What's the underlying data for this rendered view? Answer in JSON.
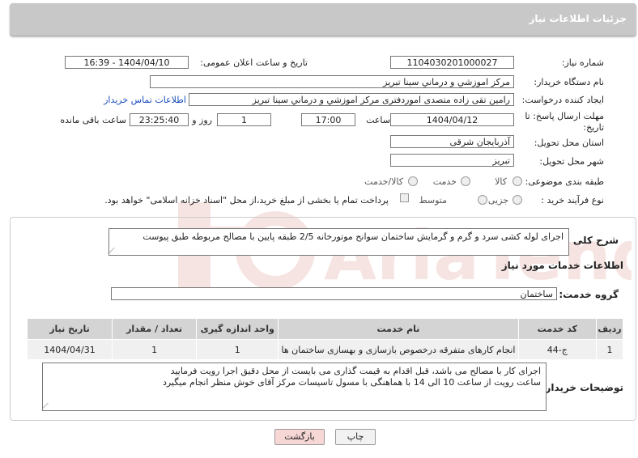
{
  "header": {
    "title": "جزئیات اطلاعات نیاز"
  },
  "fields": {
    "need_number_label": "شماره نیاز:",
    "need_number": "1104030201000027",
    "announce_label": "تاریخ و ساعت اعلان عمومی:",
    "announce_value": "1404/04/10 - 16:39",
    "buyer_label": "نام دستگاه خریدار:",
    "buyer_value": "مرکز اموزشي و درماني سينا تبريز",
    "creator_label": "ایجاد کننده درخواست:",
    "creator_value": "رامین تقی زاده متصدی اموردفتری مرکز اموزشي و درماني سينا تبريز",
    "contact_link": "اطلاعات تماس خریدار",
    "deadline_label_1": "مهلت ارسال پاسخ: تا",
    "deadline_label_2": "تاریخ:",
    "deadline_date": "1404/04/12",
    "time_label": "ساعت",
    "deadline_time": "17:00",
    "days_value": "1",
    "days_label": "روز و",
    "remaining_time": "23:25:40",
    "remaining_label": "ساعت باقی مانده",
    "province_label": "استان محل تحویل:",
    "province_value": "آذربایجان شرقی",
    "city_label": "شهر محل تحویل:",
    "city_value": "تبریز",
    "category_label": "طبقه بندی موضوعی:",
    "category_options": [
      "کالا",
      "خدمت",
      "کالا/خدمت"
    ],
    "process_label": "نوع فرآیند خرید :",
    "process_options": [
      "جزیی",
      "متوسط"
    ],
    "payment_note": "پرداخت تمام یا بخشی از مبلغ خرید،از محل \"اسناد خزانه اسلامی\" خواهد بود."
  },
  "general_desc": {
    "label": "شرح کلی نیاز:",
    "value": "اجرای لوله کشی سرد و گرم و گرمایش ساختمان سوانح موتورخانه 2/5 طبقه پایین با مصالح مربوطه طبق پیوست"
  },
  "services": {
    "section_title": "اطلاعات خدمات مورد نیاز",
    "group_label": "گروه خدمت:",
    "group_value": "ساختمان",
    "columns": [
      "ردیف",
      "کد خدمت",
      "نام خدمت",
      "واحد اندازه گیری",
      "تعداد / مقدار",
      "تاریخ نیاز"
    ],
    "rows": [
      [
        "1",
        "ج-44",
        "انجام کارهای متفرقه درخصوص بازسازی و بهسازی ساختمان ها",
        "1",
        "1",
        "1404/04/31"
      ]
    ]
  },
  "buyer_notes": {
    "label": "توضیحات خریدار:",
    "line1": "اجرای کار با مصالح می باشد، قبل اقدام به قیمت گذاری می بایست از محل دقیق اجرا رویت فرمایید",
    "line2": "ساعت رویت از ساعت 10 الی 14 با هماهنگی با مسول تاسیسات مرکز آقای خوش منظر انجام میگیرد"
  },
  "buttons": {
    "print": "چاپ",
    "back": "بازگشت"
  },
  "watermark": "AriaTender.neT",
  "colors": {
    "header_bg": "#c8c8c8",
    "link": "#1a4dbd",
    "back_btn_bg": "#f7d6d6",
    "watermark": "#c0392b"
  }
}
